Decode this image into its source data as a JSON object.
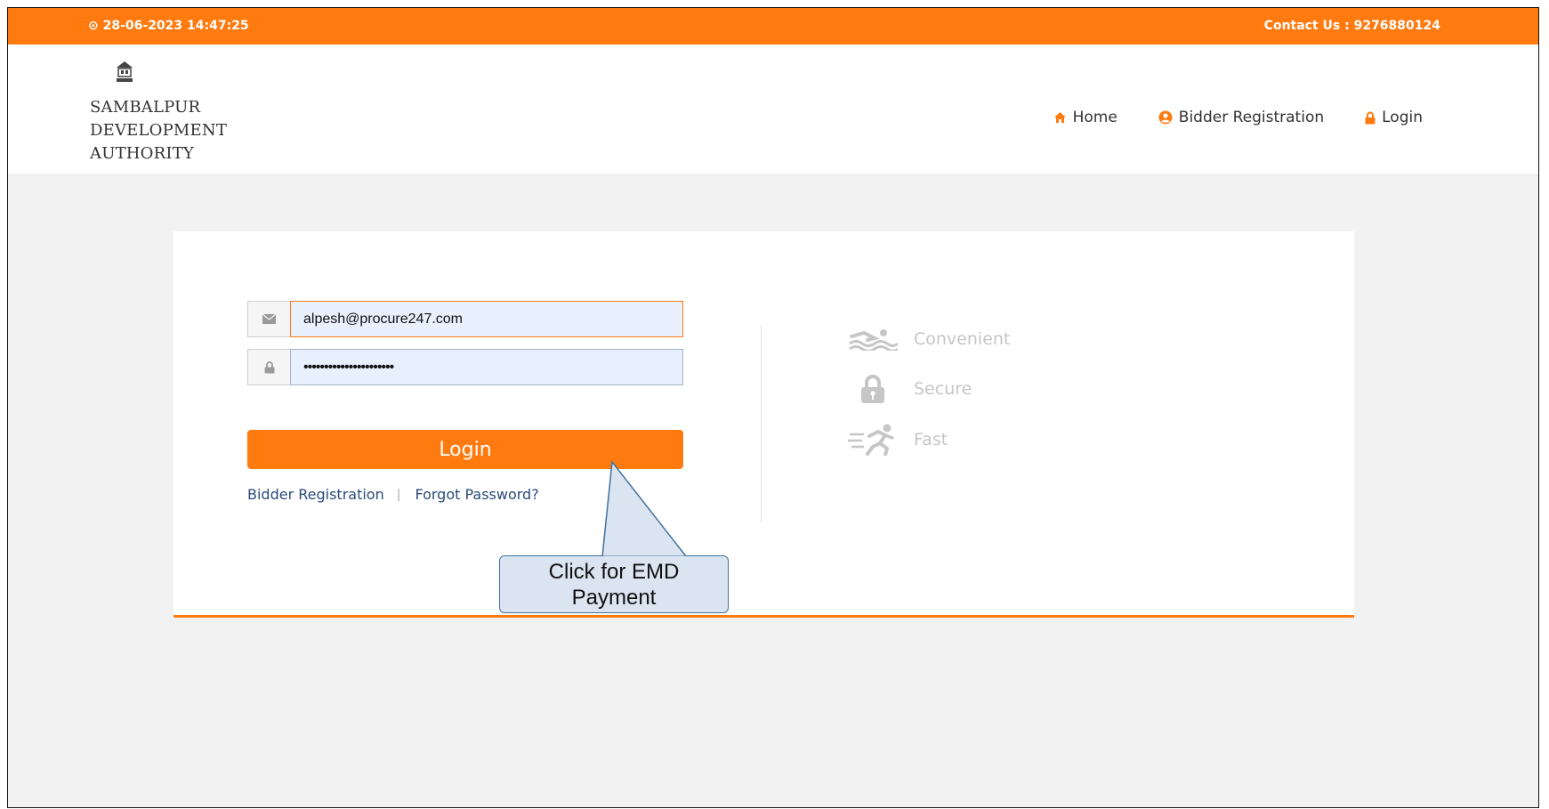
{
  "topbar": {
    "datetime": "⊙ 28-06-2023 14:47:25",
    "contact": "Contact Us : 9276880124",
    "background": "#ff7a0f"
  },
  "logo": {
    "icon": "emblem-icon",
    "lines": [
      "SAMBALPUR",
      "DEVELOPMENT",
      "AUTHORITY"
    ]
  },
  "nav": {
    "home_icon": "home-icon",
    "home": "Home",
    "register_icon": "user-circle-icon",
    "register": "Bidder Registration",
    "login_icon": "lock-icon",
    "login": "Login"
  },
  "form": {
    "email_icon": "envelope-icon",
    "email_value": "alpesh@procure247.com",
    "password_icon": "lock-icon",
    "password_value": "••••••••••••••••••••••",
    "login_button": "Login",
    "link_register": "Bidder Registration",
    "link_forgot": "Forgot Password?"
  },
  "features": [
    {
      "icon": "swimmer-icon",
      "label": "Convenient"
    },
    {
      "icon": "lock-icon",
      "label": "Secure"
    },
    {
      "icon": "running-icon",
      "label": "Fast"
    }
  ],
  "callout": {
    "line1": "Click for EMD",
    "line2": "Payment"
  },
  "colors": {
    "accent": "#ff7a0f",
    "link": "#2b4a7a",
    "callout_fill": "#dbe5f1",
    "callout_border": "#41719c"
  }
}
